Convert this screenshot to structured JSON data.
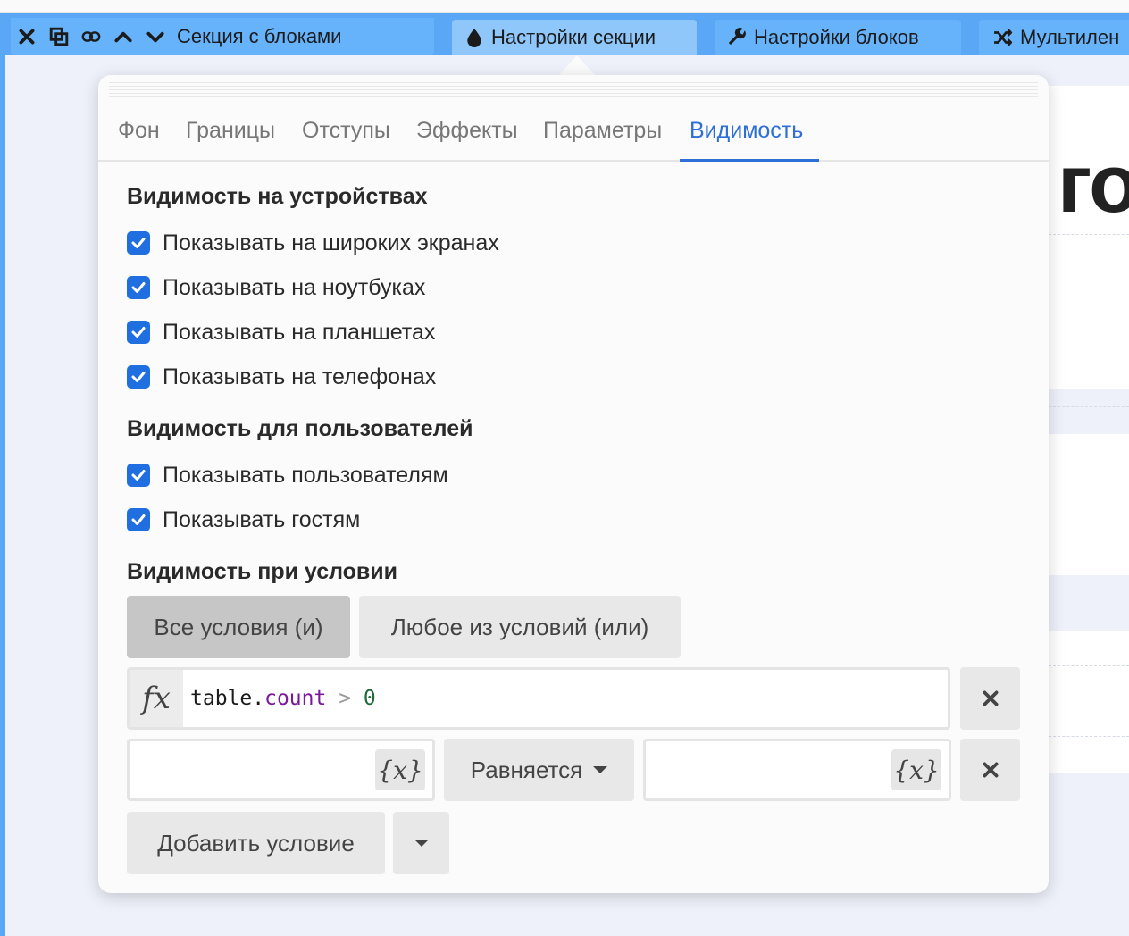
{
  "toolbar": {
    "section_label": "Секция с блоками",
    "section_settings": "Настройки секции",
    "block_settings": "Настройки блоков",
    "multi": "Мультилен"
  },
  "background": {
    "big_text": "го"
  },
  "tabs": [
    {
      "label": "Фон",
      "active": false
    },
    {
      "label": "Границы",
      "active": false
    },
    {
      "label": "Отступы",
      "active": false
    },
    {
      "label": "Эффекты",
      "active": false
    },
    {
      "label": "Параметры",
      "active": false
    },
    {
      "label": "Видимость",
      "active": true
    }
  ],
  "devices": {
    "title": "Видимость на устройствах",
    "items": [
      {
        "label": "Показывать на широких экранах",
        "checked": true
      },
      {
        "label": "Показывать на ноутбуках",
        "checked": true
      },
      {
        "label": "Показывать на планшетах",
        "checked": true
      },
      {
        "label": "Показывать на телефонах",
        "checked": true
      }
    ]
  },
  "users": {
    "title": "Видимость для пользователей",
    "items": [
      {
        "label": "Показывать пользователям",
        "checked": true
      },
      {
        "label": "Показывать гостям",
        "checked": true
      }
    ]
  },
  "condition": {
    "title": "Видимость при условии",
    "mode_all": "Все условия (и)",
    "mode_any": "Любое из условий (или)",
    "active_mode": "all",
    "fx_label": "fx",
    "formula": {
      "var": "table",
      "dot": ".",
      "prop": "count",
      "op": " > ",
      "num": "0"
    },
    "left_value": "",
    "right_value": "",
    "var_button": "{x}",
    "operator": "Равняется",
    "add_label": "Добавить условие"
  },
  "colors": {
    "toolbar": "#66b3fb",
    "accent": "#2d6fd6",
    "checkbox": "#1f6fe0"
  }
}
